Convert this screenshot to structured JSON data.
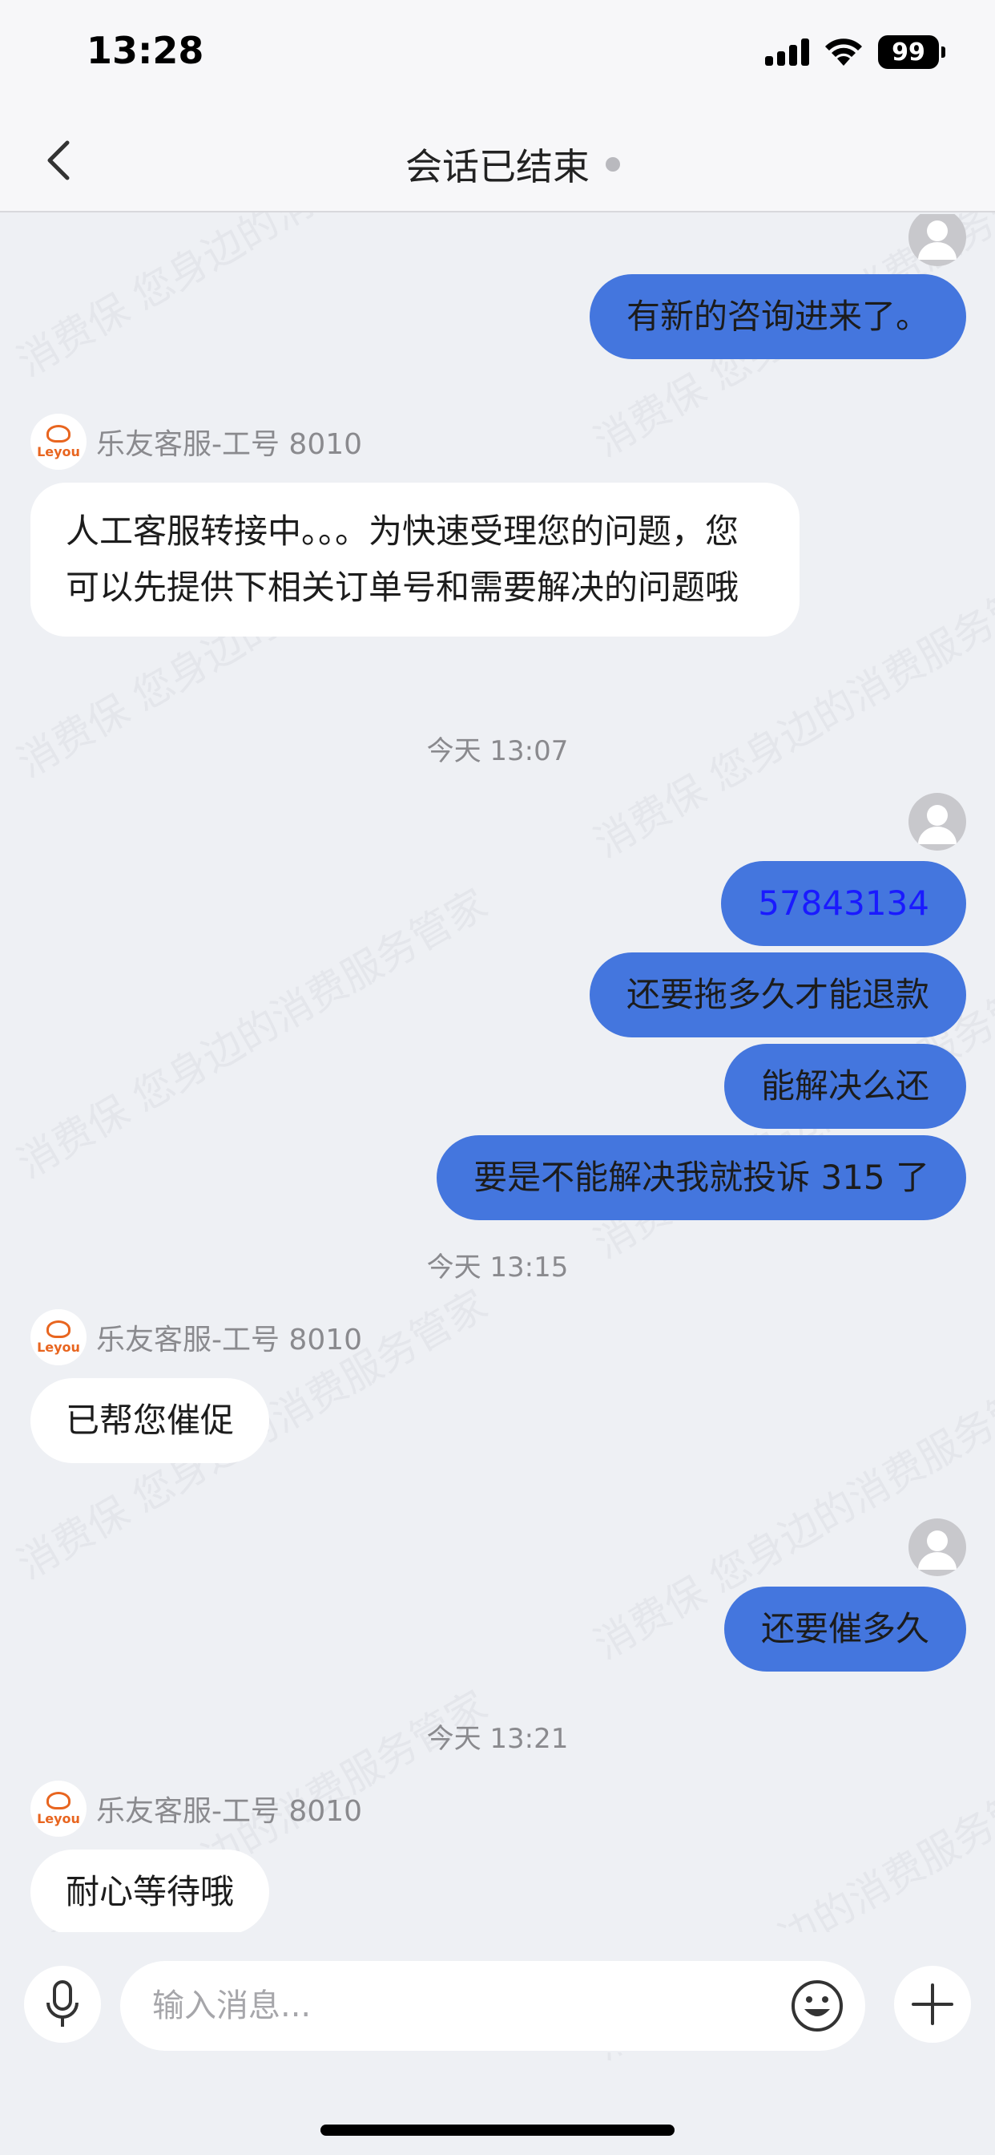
{
  "status_bar": {
    "time": "13:28",
    "battery": "99"
  },
  "nav": {
    "title": "会话已结束"
  },
  "messages": {
    "m1": "有新的咨询进来了。",
    "agent1_name": "乐友客服-工号 8010",
    "m2": "人工客服转接中。。。为快速受理您的问题，您可以先提供下相关订单号和需要解决的问题哦",
    "t1": "今天 13:07",
    "m3": "57843134",
    "m4": "还要拖多久才能退款",
    "m5": "能解决么还",
    "m6": "要是不能解决我就投诉 315 了",
    "t2": "今天 13:15",
    "agent2_name": "乐友客服-工号 8010",
    "m7": "已帮您催促",
    "m8": "还要催多久",
    "t3": "今天 13:21",
    "agent3_name": "乐友客服-工号 8010",
    "m9": "耐心等待哦"
  },
  "agent_logo_text": "Leyou",
  "input": {
    "placeholder": "输入消息..."
  },
  "watermark_text": "消费保 您身边的消费服务管家",
  "colors": {
    "outgoing_bubble": "#4476de",
    "link": "#1a1aff",
    "brand": "#e8651f"
  }
}
